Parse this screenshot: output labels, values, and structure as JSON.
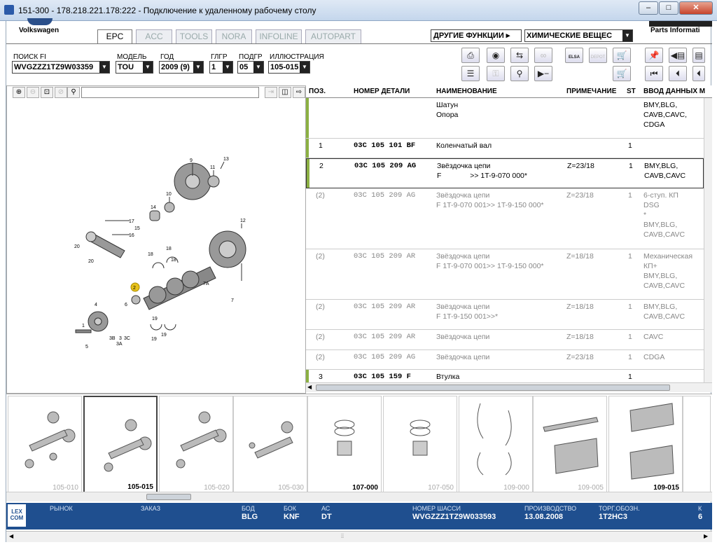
{
  "window": {
    "title": "151-300 - 178.218.221.178:222 - Подключение к удаленному рабочему столу"
  },
  "brand": {
    "name": "Volkswagen",
    "right_text": "Parts Informati"
  },
  "tabs": [
    {
      "label": "EPC"
    },
    {
      "label": "ACC"
    },
    {
      "label": "TOOLS"
    },
    {
      "label": "NORA"
    },
    {
      "label": "INFOLINE"
    },
    {
      "label": "AUTOPART"
    }
  ],
  "functions": {
    "label": "ДРУГИЕ ФУНКЦИИ ▸",
    "value": "ХИМИЧЕСКИЕ ВЕЩЕС"
  },
  "filters": {
    "search": {
      "label": "ПОИСК FI",
      "value": "WVGZZZ1TZ9W03359"
    },
    "model": {
      "label": "МОДЕЛЬ",
      "value": "TOU"
    },
    "year": {
      "label": "ГОД",
      "value": "2009 (9)"
    },
    "group": {
      "label": "ГЛГР",
      "value": "1"
    },
    "subgroup": {
      "label": "ПОДГР",
      "value": "05"
    },
    "illustration": {
      "label": "ИЛЛЮСТРАЦИЯ",
      "value": "105-015"
    }
  },
  "toolbar": {
    "row1": [
      "print-icon",
      "disc-icon",
      "car-transfer-icon",
      "handshake-icon",
      "elsa-icon",
      "depot-icon",
      "cart-add-icon",
      "pin-icon",
      "previous-page-icon",
      "next-page-icon"
    ],
    "row1_labels": {
      "elsa": "ELSA",
      "depot": "DEPOT"
    },
    "row2": [
      "list-icon",
      "key-icon",
      "bike-icon",
      "play-minus-icon",
      "cart-icon",
      "first-icon",
      "back-icon",
      "back2-icon"
    ]
  },
  "table": {
    "headers": [
      "ПОЗ.",
      "НОМЕР ДЕТАЛИ",
      "НАИМЕНОВАНИЕ",
      "ПРИМЕЧАНИЕ",
      "ST",
      "ВВОД ДАННЫХ М"
    ],
    "rows": [
      {
        "pos": "",
        "pn": "",
        "name": "Шатун\nОпора",
        "note": "",
        "st": "",
        "data": "BMY,BLG,\nCAVB,CAVC,\nCDGA",
        "gray": false
      },
      {
        "pos": "1",
        "pn": "03C 105 101 BF",
        "name": "Коленчатый вал",
        "note": "",
        "st": "1",
        "data": "",
        "gray": false
      },
      {
        "pos": "2",
        "pn": "03C 105 209 AG",
        "name": "Звёздочка цепи\nF              >> 1T-9-070 000*",
        "note": "Z=23/18",
        "st": "1",
        "data": "BMY,BLG,\nCAVB,CAVC",
        "gray": false
      },
      {
        "pos": "(2)",
        "pn": "03C 105 209 AG",
        "name": "Звёздочка цепи\nF 1T-9-070 001>> 1T-9-150 000*",
        "note": "Z=23/18",
        "st": "1",
        "data": "6-ступ. КП\nDSG\n*\nBMY,BLG,\nCAVB,CAVC",
        "gray": true
      },
      {
        "pos": "(2)",
        "pn": "03C 105 209 AR",
        "name": "Звёздочка цепи\nF 1T-9-070 001>> 1T-9-150 000*",
        "note": "Z=18/18",
        "st": "1",
        "data": "Механическая\nКП+\nBMY,BLG,\nCAVB,CAVC",
        "gray": true
      },
      {
        "pos": "(2)",
        "pn": "03C 105 209 AR",
        "name": "Звёздочка цепи\nF 1T-9-150 001>>*",
        "note": "Z=18/18",
        "st": "1",
        "data": "BMY,BLG,\nCAVB,CAVC",
        "gray": true
      },
      {
        "pos": "(2)",
        "pn": "03C 105 209 AR",
        "name": "Звёздочка цепи",
        "note": "Z=18/18",
        "st": "1",
        "data": "CAVC",
        "gray": true
      },
      {
        "pos": "(2)",
        "pn": "03C 105 209 AG",
        "name": "Звёздочка цепи",
        "note": "Z=23/18",
        "st": "1",
        "data": "CDGA",
        "gray": true
      },
      {
        "pos": "3",
        "pn": "03C 105 159 F",
        "name": "Втулка",
        "note": "",
        "st": "1",
        "data": "",
        "gray": false
      }
    ]
  },
  "diagram_labels": [
    "9",
    "11",
    "13",
    "10",
    "14",
    "17",
    "15",
    "16",
    "12",
    "20",
    "20",
    "18",
    "18",
    "18",
    "19",
    "19",
    "19",
    "7A",
    "7",
    "2",
    "6",
    "4",
    "1",
    "3B",
    "3",
    "3C",
    "3A",
    "5"
  ],
  "thumbnails": [
    {
      "label": "105-010",
      "bold": false
    },
    {
      "label": "105-015",
      "bold": true
    },
    {
      "label": "105-020",
      "bold": false
    },
    {
      "label": "105-030",
      "bold": false
    },
    {
      "label": "107-000",
      "bold": true
    },
    {
      "label": "107-050",
      "bold": false
    },
    {
      "label": "109-000",
      "bold": false
    },
    {
      "label": "109-005",
      "bold": false
    },
    {
      "label": "109-015",
      "bold": true
    }
  ],
  "status": {
    "lexcom": "LEX\nCOM",
    "fields": [
      {
        "k": "РЫНОК",
        "v": ""
      },
      {
        "k": "ЗАКАЗ",
        "v": ""
      },
      {
        "k": "БОД",
        "v": "BLG"
      },
      {
        "k": "БОК",
        "v": "KNF"
      },
      {
        "k": "АС",
        "v": "DT"
      },
      {
        "k": "НОМЕР ШАССИ",
        "v": "WVGZZZ1TZ9W033593"
      },
      {
        "k": "ПРОИЗВОДСТВО",
        "v": "13.08.2008"
      },
      {
        "k": "ТОРГ.ОБОЗН.",
        "v": "1T2HC3"
      },
      {
        "k": "К",
        "v": "6"
      }
    ]
  },
  "colors": {
    "accent_green": "#8cb043",
    "status_blue": "#1f4f8f",
    "marker_yellow": "#e8c21a"
  }
}
